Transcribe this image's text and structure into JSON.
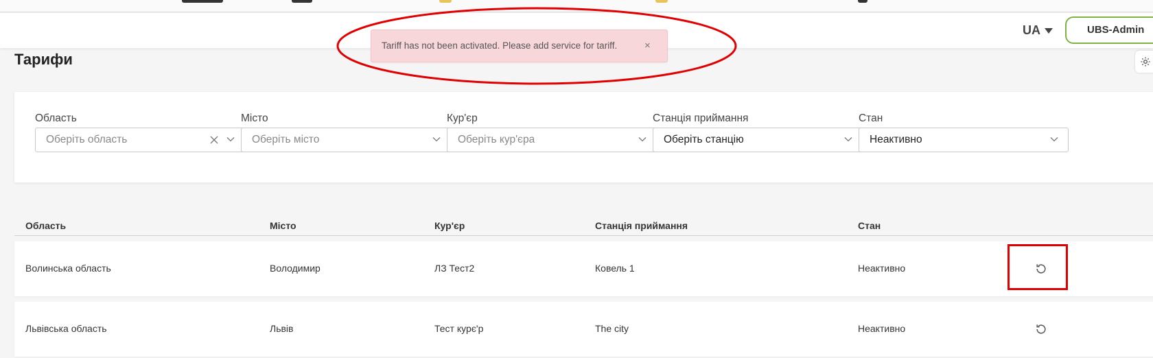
{
  "header": {
    "language": "UA",
    "user_button": "UBS-Admin"
  },
  "page": {
    "title": "Тарифи"
  },
  "toast": {
    "message": "Tariff has not been activated. Please add service for tariff.",
    "close": "×"
  },
  "filters": [
    {
      "label": "Область",
      "placeholder": "Оберіть область",
      "value": "",
      "clearable": true
    },
    {
      "label": "Місто",
      "placeholder": "Оберіть місто",
      "value": ""
    },
    {
      "label": "Кур'єр",
      "placeholder": "Оберіть кур'єра",
      "value": ""
    },
    {
      "label": "Станція приймання",
      "placeholder": "Оберіть станцію",
      "value": ""
    },
    {
      "label": "Стан",
      "placeholder": "",
      "value": "Неактивно"
    }
  ],
  "table": {
    "columns": [
      "Область",
      "Місто",
      "Кур'єр",
      "Станція приймання",
      "Стан"
    ],
    "rows": [
      {
        "region": "Волинська область",
        "city": "Володимир",
        "courier": "ЛЗ Тест2",
        "station": "Ковель 1",
        "status": "Неактивно"
      },
      {
        "region": "Львівська область",
        "city": "Львів",
        "courier": "Тест курє'р",
        "station": "The city",
        "status": "Неактивно"
      }
    ]
  },
  "colors": {
    "accent_green": "#7cb342",
    "toast_bg": "#f8d7da",
    "annotation_red": "#e00000"
  },
  "icons": [
    "caret-down-icon",
    "gear-icon",
    "close-icon",
    "chevron-down-icon",
    "restore-icon"
  ]
}
